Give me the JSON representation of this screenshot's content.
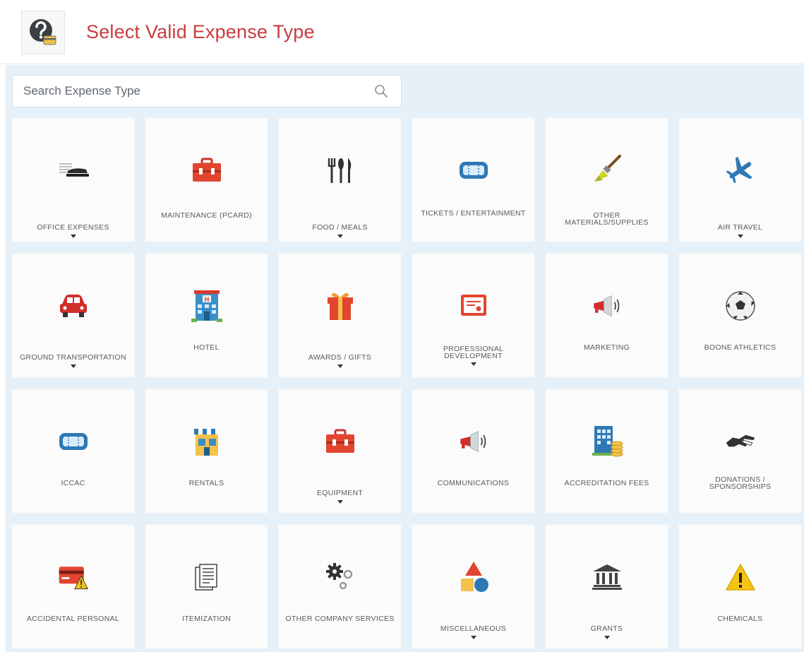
{
  "header": {
    "title": "Select Valid Expense Type",
    "icon": "question-help-icon"
  },
  "search": {
    "placeholder": "Search Expense Type",
    "icon": "search-icon"
  },
  "colors": {
    "title": "#c83c3f",
    "panel_background": "#e6f0f8",
    "icon_red": "#e2452f",
    "icon_blue": "#2f78b5"
  },
  "expense_types": [
    {
      "label": "OFFICE EXPENSES",
      "icon": "stapler-icon",
      "has_dropdown": true
    },
    {
      "label": "MAINTENANCE (PCARD)",
      "icon": "toolbox-icon",
      "has_dropdown": false
    },
    {
      "label": "FOOD / MEALS",
      "icon": "cutlery-icon",
      "has_dropdown": true
    },
    {
      "label": "TICKETS / ENTERTAINMENT",
      "icon": "ticket-icon",
      "has_dropdown": false
    },
    {
      "label": "OTHER MATERIALS/SUPPLIES",
      "icon": "paintbrush-icon",
      "has_dropdown": false
    },
    {
      "label": "AIR TRAVEL",
      "icon": "airplane-icon",
      "has_dropdown": true
    },
    {
      "label": "GROUND TRANSPORTATION",
      "icon": "car-icon",
      "has_dropdown": true
    },
    {
      "label": "HOTEL",
      "icon": "hotel-icon",
      "has_dropdown": false
    },
    {
      "label": "AWARDS / GIFTS",
      "icon": "gift-icon",
      "has_dropdown": true
    },
    {
      "label": "PROFESSIONAL DEVELOPMENT",
      "icon": "certificate-icon",
      "has_dropdown": true
    },
    {
      "label": "MARKETING",
      "icon": "megaphone-icon",
      "has_dropdown": false
    },
    {
      "label": "BOONE ATHLETICS",
      "icon": "soccer-ball-icon",
      "has_dropdown": false
    },
    {
      "label": "ICCAC",
      "icon": "ticket-icon",
      "has_dropdown": false
    },
    {
      "label": "RENTALS",
      "icon": "storefront-icon",
      "has_dropdown": false
    },
    {
      "label": "EQUIPMENT",
      "icon": "toolbox-icon",
      "has_dropdown": true
    },
    {
      "label": "COMMUNICATIONS",
      "icon": "megaphone-icon",
      "has_dropdown": false
    },
    {
      "label": "ACCREDITATION FEES",
      "icon": "building-coins-icon",
      "has_dropdown": false
    },
    {
      "label": "DONATIONS / SPONSORSHIPS",
      "icon": "handshake-icon",
      "has_dropdown": false
    },
    {
      "label": "ACCIDENTAL PERSONAL",
      "icon": "credit-card-warning-icon",
      "has_dropdown": false
    },
    {
      "label": "ITEMIZATION",
      "icon": "documents-icon",
      "has_dropdown": false
    },
    {
      "label": "OTHER COMPANY SERVICES",
      "icon": "gears-icon",
      "has_dropdown": false
    },
    {
      "label": "MISCELLANEOUS",
      "icon": "shapes-icon",
      "has_dropdown": true
    },
    {
      "label": "GRANTS",
      "icon": "bank-icon",
      "has_dropdown": true
    },
    {
      "label": "CHEMICALS",
      "icon": "warning-icon",
      "has_dropdown": false
    }
  ]
}
